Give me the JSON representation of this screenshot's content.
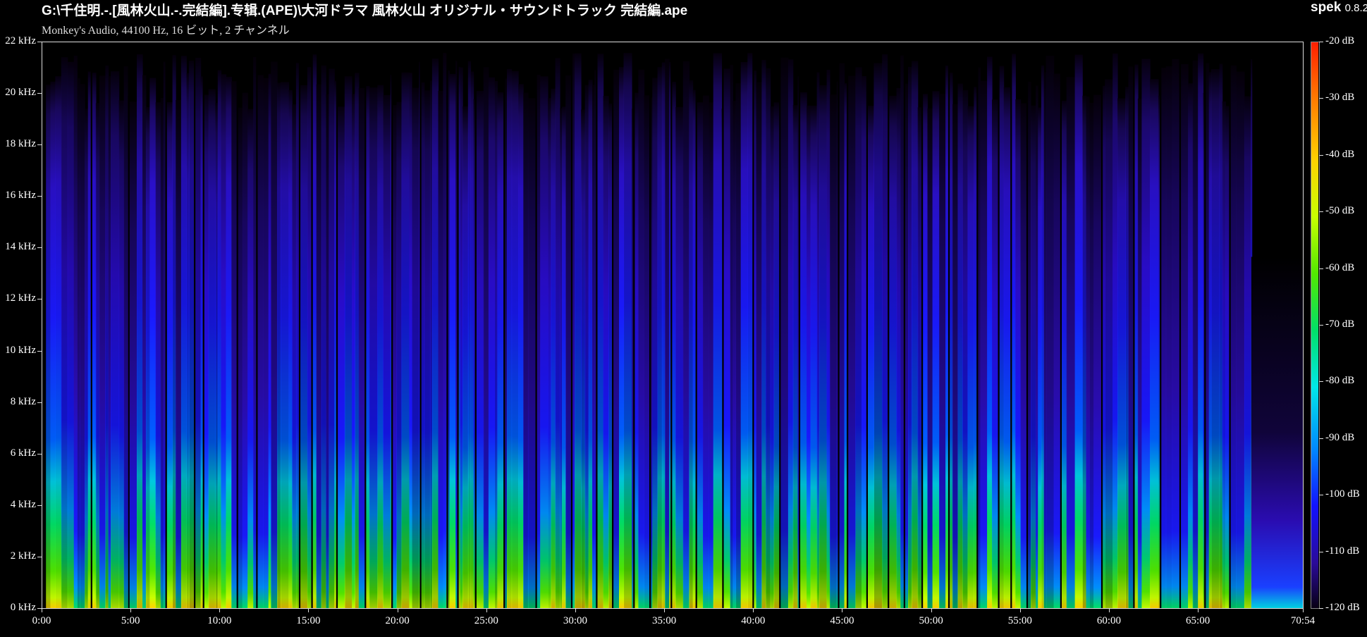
{
  "header": {
    "title": "G:\\千住明.-.[風林火山.-.完結編].专辑.(APE)\\大河ドラマ 風林火山 オリジナル・サウンドトラック 完結編.ape",
    "subtitle": "Monkey's Audio, 44100 Hz, 16 ビット, 2 チャンネル",
    "app_name": "spek",
    "app_version": "0.8.2"
  },
  "frequency_axis": {
    "labels": [
      "22 kHz",
      "20 kHz",
      "18 kHz",
      "16 kHz",
      "14 kHz",
      "12 kHz",
      "10 kHz",
      "8 kHz",
      "6 kHz",
      "4 kHz",
      "2 kHz",
      "0 kHz"
    ],
    "values_khz": [
      22,
      20,
      18,
      16,
      14,
      12,
      10,
      8,
      6,
      4,
      2,
      0
    ],
    "max_khz": 22
  },
  "time_axis": {
    "labels": [
      "0:00",
      "5:00",
      "10:00",
      "15:00",
      "20:00",
      "25:00",
      "30:00",
      "35:00",
      "40:00",
      "45:00",
      "50:00",
      "55:00",
      "60:00",
      "65:00",
      "70:54"
    ],
    "values_min": [
      0,
      5,
      10,
      15,
      20,
      25,
      30,
      35,
      40,
      45,
      50,
      55,
      60,
      65,
      70.9
    ],
    "max_min": 70.9
  },
  "db_scale": {
    "labels": [
      "-20 dB",
      "-30 dB",
      "-40 dB",
      "-50 dB",
      "-60 dB",
      "-70 dB",
      "-80 dB",
      "-90 dB",
      "-100 dB",
      "-110 dB",
      "-120 dB"
    ],
    "values_db": [
      -20,
      -30,
      -40,
      -50,
      -60,
      -70,
      -80,
      -90,
      -100,
      -110,
      -120
    ]
  },
  "colors": {
    "background": "#000000",
    "axis": "#dddddd",
    "text": "#ffffff",
    "palette": [
      "#080015",
      "#2a0a9a",
      "#1212ff",
      "#0088ff",
      "#00e8e8",
      "#00e068",
      "#52e800",
      "#c8ff00",
      "#ffd200",
      "#ff7a00",
      "#ff1e00"
    ]
  },
  "track_boundaries_min": [
    0.2,
    2.8,
    4.9,
    7.0,
    8.6,
    9.1,
    11.0,
    12.1,
    14.5,
    15.2,
    16.6,
    18.2,
    19.7,
    21.3,
    22.8,
    23.4,
    24.4,
    26.0,
    27.8,
    29.8,
    31.2,
    32.1,
    33.3,
    34.2,
    35.4,
    36.8,
    38.3,
    40.0,
    41.5,
    42.6,
    44.8,
    45.3,
    46.4,
    47.6,
    48.5,
    49.5,
    51.0,
    52.6,
    53.8,
    54.5,
    55.4,
    57.3,
    59.6,
    61.4,
    62.9,
    64.0,
    65.4,
    66.8,
    68.1
  ]
}
